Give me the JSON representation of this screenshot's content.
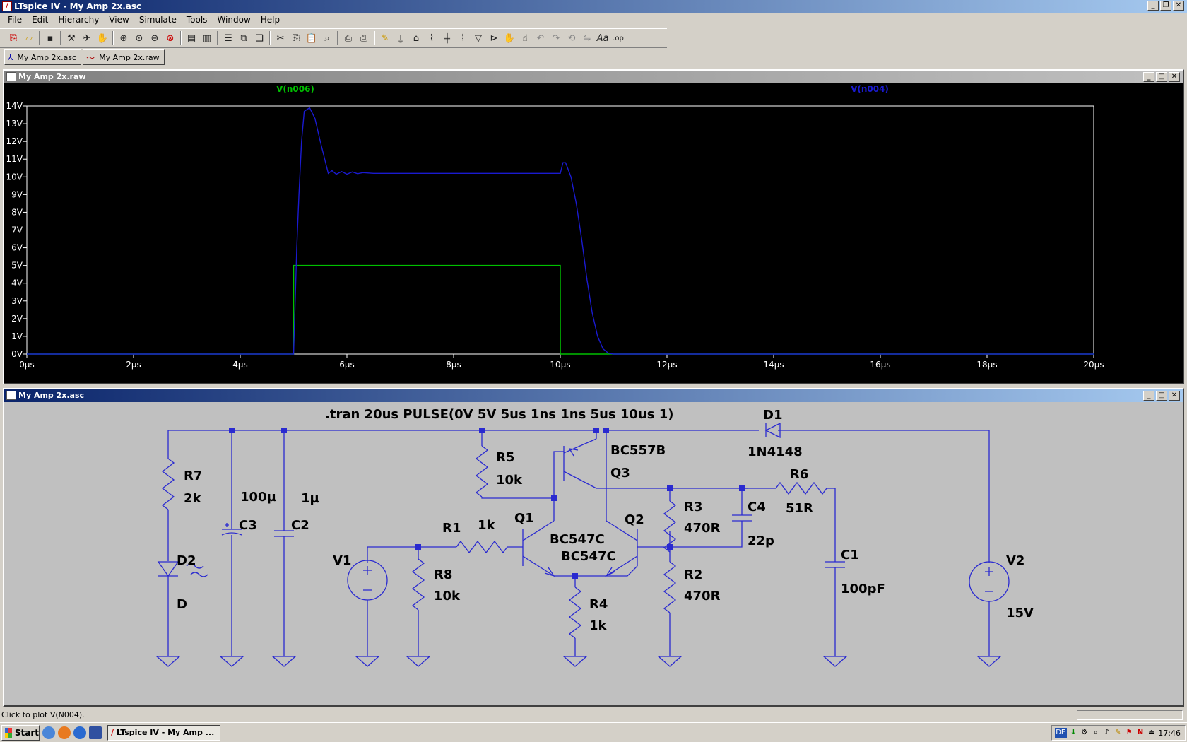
{
  "window": {
    "title": "LTspice IV - My Amp 2x.asc"
  },
  "menu": [
    "File",
    "Edit",
    "Hierarchy",
    "View",
    "Simulate",
    "Tools",
    "Window",
    "Help"
  ],
  "toolbar_icons": [
    "new-schematic-icon",
    "open-icon",
    "save-icon",
    "control-panel-icon",
    "run-icon",
    "halt-icon",
    "zoom-in-icon",
    "zoom-full-icon",
    "zoom-out-icon",
    "zoom-cancel-icon",
    "autorange-icon",
    "split-icon",
    "tile-horizontal-icon",
    "tile-vertical-icon",
    "cascade-icon",
    "cut-icon",
    "copy-icon",
    "paste-icon",
    "find-icon",
    "print-setup-icon",
    "print-icon",
    "wire-icon",
    "ground-icon",
    "label-icon",
    "resistor-icon",
    "capacitor-icon",
    "inductor-icon",
    "diode-icon",
    "component-icon",
    "move-icon",
    "drag-icon",
    "undo-icon",
    "redo-icon",
    "rotate-icon",
    "mirror-icon",
    "text-icon",
    "spice-directive-icon"
  ],
  "tabs": [
    {
      "label": "My Amp 2x.asc",
      "icon": "schematic-icon"
    },
    {
      "label": "My Amp 2x.raw",
      "icon": "waveform-icon"
    }
  ],
  "waveform": {
    "title": "My Amp 2x.raw",
    "colors": {
      "trace_n006": "#00c000",
      "trace_n004": "#1a1ad0",
      "axis": "#ffffff",
      "grid_bg": "#000000"
    },
    "chart_data": {
      "type": "line",
      "xlabel": "",
      "ylabel": "",
      "x_ticks": [
        "0µs",
        "2µs",
        "4µs",
        "6µs",
        "8µs",
        "10µs",
        "12µs",
        "14µs",
        "16µs",
        "18µs",
        "20µs"
      ],
      "y_ticks": [
        "14V",
        "13V",
        "12V",
        "11V",
        "10V",
        "9V",
        "8V",
        "7V",
        "6V",
        "5V",
        "4V",
        "3V",
        "2V",
        "1V",
        "0V"
      ],
      "xlim": [
        0,
        20
      ],
      "ylim": [
        0,
        14
      ],
      "x_unit": "µs",
      "y_unit": "V",
      "series": [
        {
          "name": "V(n006)",
          "color": "#00c000",
          "points": [
            [
              0,
              0
            ],
            [
              5,
              0
            ],
            [
              5.001,
              5
            ],
            [
              10,
              5
            ],
            [
              10.001,
              0
            ],
            [
              20,
              0
            ]
          ]
        },
        {
          "name": "V(n004)",
          "color": "#1a1ad0",
          "points": [
            [
              0,
              0
            ],
            [
              5,
              0
            ],
            [
              5.03,
              3
            ],
            [
              5.06,
              6
            ],
            [
              5.1,
              9
            ],
            [
              5.15,
              12
            ],
            [
              5.2,
              13.7
            ],
            [
              5.3,
              13.9
            ],
            [
              5.4,
              13.3
            ],
            [
              5.5,
              12
            ],
            [
              5.6,
              10.8
            ],
            [
              5.65,
              10.2
            ],
            [
              5.72,
              10.35
            ],
            [
              5.8,
              10.15
            ],
            [
              5.9,
              10.3
            ],
            [
              6.0,
              10.15
            ],
            [
              6.1,
              10.28
            ],
            [
              6.2,
              10.18
            ],
            [
              6.3,
              10.24
            ],
            [
              6.5,
              10.2
            ],
            [
              7,
              10.2
            ],
            [
              8,
              10.2
            ],
            [
              9,
              10.2
            ],
            [
              10,
              10.2
            ],
            [
              10.05,
              10.8
            ],
            [
              10.1,
              10.8
            ],
            [
              10.2,
              10
            ],
            [
              10.3,
              8.5
            ],
            [
              10.4,
              6.5
            ],
            [
              10.5,
              4.2
            ],
            [
              10.6,
              2.3
            ],
            [
              10.7,
              1
            ],
            [
              10.8,
              0.3
            ],
            [
              10.9,
              0.05
            ],
            [
              11,
              0
            ],
            [
              20,
              0
            ]
          ]
        }
      ]
    }
  },
  "schematic": {
    "title": "My Amp 2x.asc",
    "directive": ".tran 20us   PULSE(0V 5V 5us 1ns 1ns 5us 10us 1)",
    "wire_color": "#2a2ad0",
    "labels": {
      "R7": "R7",
      "R7v": "2k",
      "C3": "C3",
      "C3v": "100µ",
      "C2": "C2",
      "C2v": "1µ",
      "D2": "D2",
      "D2v": "D",
      "V1": "V1",
      "R8": "R8",
      "R8v": "10k",
      "R1": "R1",
      "R1v": "1k",
      "R5": "R5",
      "R5v": "10k",
      "Q1": "Q1",
      "Q1v": "BC547C",
      "Q2": "Q2",
      "Q2v": "BC547C",
      "Q3": "Q3",
      "Q3v": "BC557B",
      "R4": "R4",
      "R4v": "1k",
      "R3": "R3",
      "R3v": "470R",
      "R2": "R2",
      "R2v": "470R",
      "C4": "C4",
      "C4v": "22p",
      "R6": "R6",
      "R6v": "51R",
      "C1": "C1",
      "C1v": "100pF",
      "D1": "D1",
      "D1v": "1N4148",
      "V2": "V2",
      "V2v": "15V"
    }
  },
  "status": {
    "text": "Click to plot V(N004)."
  },
  "taskbar": {
    "start": "Start",
    "task": "LTspice IV - My Amp ...",
    "clock": "17:46",
    "lang": "DE"
  }
}
